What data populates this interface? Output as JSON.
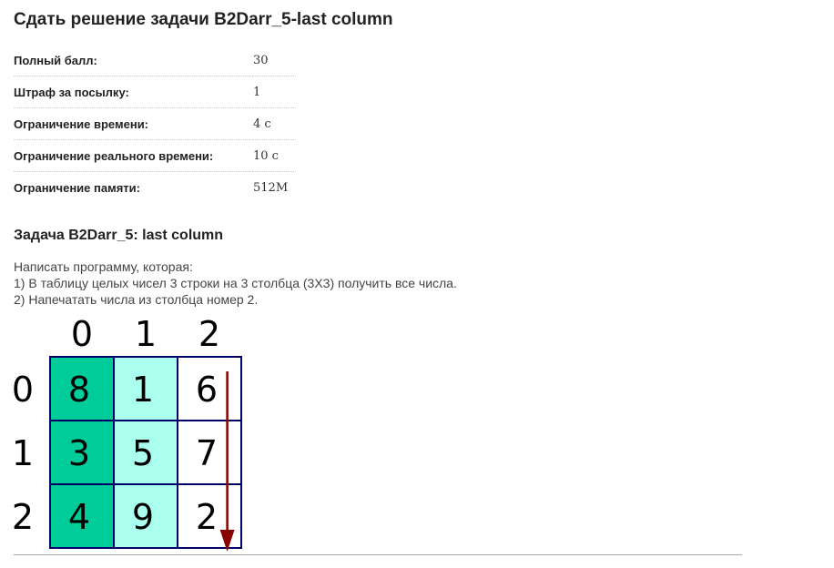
{
  "page": {
    "title": "Сдать решение задачи B2Darr_5-last column"
  },
  "properties": [
    {
      "label": "Полный балл:",
      "value": "30"
    },
    {
      "label": "Штраф за посылку:",
      "value": "1"
    },
    {
      "label": "Ограничение времени:",
      "value": "4 с"
    },
    {
      "label": "Ограничение реального времени:",
      "value": "10 с"
    },
    {
      "label": "Ограничение памяти:",
      "value": "512M"
    }
  ],
  "problem": {
    "heading": "Задача B2Darr_5: last column",
    "statement": [
      "Написать программу, которая:",
      "1) В таблицу целых чисел 3 строки на 3 столбца (3X3) получить все числа.",
      "2) Напечатать числа из столбца номер 2."
    ]
  },
  "figure": {
    "column_indices": [
      "0",
      "1",
      "2"
    ],
    "row_indices": [
      "0",
      "1",
      "2"
    ],
    "cells": [
      [
        "8",
        "1",
        "6"
      ],
      [
        "3",
        "5",
        "7"
      ],
      [
        "4",
        "9",
        "2"
      ]
    ],
    "colors": {
      "column_0": "#00cc99",
      "column_1": "#aaffee",
      "column_2": "#ffffff",
      "grid_border": "#000066",
      "arrow": "#880000"
    },
    "highlighted_column": 2
  }
}
